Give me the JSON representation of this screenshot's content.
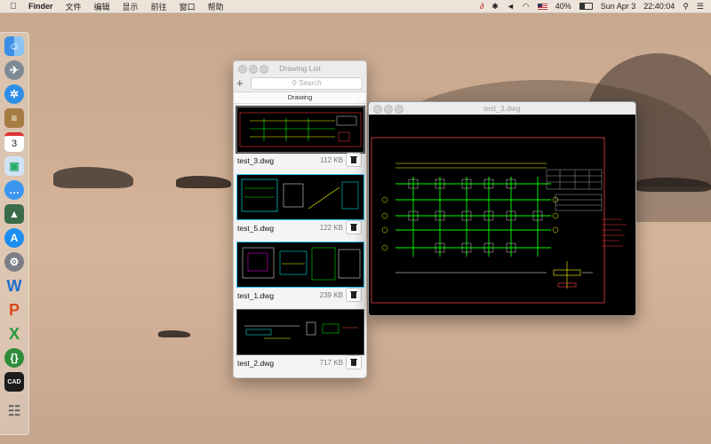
{
  "menubar": {
    "apple_icon": "apple-icon",
    "app_name": "Finder",
    "menus": [
      "文件",
      "编辑",
      "显示",
      "前往",
      "窗口",
      "帮助"
    ],
    "battery": "40%",
    "datetime_day": "Sun Apr 3",
    "datetime_time": "22:40:04",
    "status_icons": [
      "acrobat-icon",
      "bluetooth-icon",
      "volume-icon",
      "wifi-icon",
      "flag-icon",
      "battery-icon",
      "search-icon",
      "list-icon"
    ]
  },
  "dock": {
    "items": [
      "finder-icon",
      "launchpad-icon",
      "safari-icon",
      "notes-icon",
      "calendar-icon",
      "preview-icon",
      "messages-icon",
      "photo-icon",
      "app-store-icon",
      "system-preferences-icon",
      "word-icon",
      "powerpoint-icon",
      "excel-icon",
      "brackets-icon",
      "cad-viewer-icon",
      "trash-icon"
    ],
    "calendar_day": "3",
    "cad_label": "CAD"
  },
  "drawing_list": {
    "title": "Drawing List",
    "search_placeholder": "Search",
    "column_header": "Drawing",
    "files": [
      {
        "name": "test_3.dwg",
        "size": "112 KB"
      },
      {
        "name": "test_5.dwg",
        "size": "122 KB"
      },
      {
        "name": "test_1.dwg",
        "size": "239 KB"
      },
      {
        "name": "test_2.dwg",
        "size": "717 KB"
      }
    ]
  },
  "viewer": {
    "title": "test_3.dwg"
  }
}
